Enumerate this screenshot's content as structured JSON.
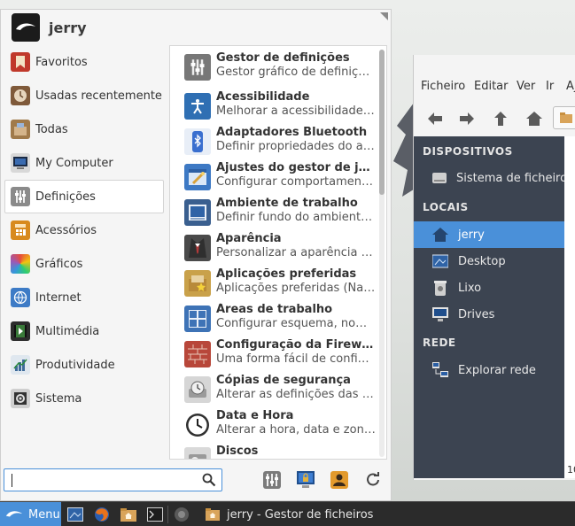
{
  "file_manager": {
    "menu": [
      "Ficheiro",
      "Editar",
      "Ver",
      "Ir",
      "Aj"
    ],
    "sections": {
      "devices": "DISPOSITIVOS",
      "places": "LOCAIS",
      "network": "REDE"
    },
    "devices": [
      {
        "label": "Sistema de ficheiros",
        "icon": "drive-icon"
      }
    ],
    "places": [
      {
        "label": "jerry",
        "icon": "home-folder-icon",
        "selected": true
      },
      {
        "label": "Desktop",
        "icon": "desktop-icon"
      },
      {
        "label": "Lixo",
        "icon": "trash-icon"
      },
      {
        "label": "Drives",
        "icon": "monitor-icon"
      }
    ],
    "network": [
      {
        "label": "Explorar rede",
        "icon": "network-icon"
      }
    ],
    "status_fragment": "10"
  },
  "menu": {
    "username": "jerry",
    "categories": [
      {
        "label": "Favoritos",
        "icon": "bookmark-icon",
        "color": "#c0392b"
      },
      {
        "label": "Usadas recentemente",
        "icon": "clock-icon",
        "color": "#7f5a3a"
      },
      {
        "label": "Todas",
        "icon": "apps-box-icon",
        "color": "#a07a4a"
      },
      {
        "label": "My Computer",
        "icon": "computer-icon",
        "color": "#2d3e55"
      },
      {
        "label": "Definições",
        "icon": "settings-sliders-icon",
        "color": "#7a7a7a",
        "selected": true
      },
      {
        "label": "Acessórios",
        "icon": "calculator-icon",
        "color": "#d88a1e"
      },
      {
        "label": "Gráficos",
        "icon": "palette-icon",
        "color": "#e34a8a"
      },
      {
        "label": "Internet",
        "icon": "globe-icon",
        "color": "#3d7bc6"
      },
      {
        "label": "Multimédia",
        "icon": "media-icon",
        "color": "#2c2c2c"
      },
      {
        "label": "Produtividade",
        "icon": "chart-icon",
        "color": "#3e6b9a"
      },
      {
        "label": "Sistema",
        "icon": "system-gear-icon",
        "color": "#555555"
      }
    ],
    "apps": [
      {
        "name": "Gestor de definições",
        "desc": "Gestor gráfico de definições do Xfce",
        "icon": "settings-sliders-icon",
        "color": "#777777"
      },
      {
        "name": "Acessibilidade",
        "desc": "Melhorar a acessibilidade do teclado e rato",
        "icon": "accessibility-icon",
        "color": "#2f6fb3"
      },
      {
        "name": "Adaptadores Bluetooth",
        "desc": "Definir propriedades do adaptador Bluetooth",
        "icon": "bluetooth-icon",
        "color": "#3a6fcf"
      },
      {
        "name": "Ajustes do gestor de janelas",
        "desc": "Configurar comportamento das janelas",
        "icon": "window-tweaks-icon",
        "color": "#3d79c4"
      },
      {
        "name": "Ambiente de trabalho",
        "desc": "Definir fundo do ambiente de trabalho",
        "icon": "desktop-settings-icon",
        "color": "#3a5f8f"
      },
      {
        "name": "Aparência",
        "desc": "Personalizar a aparência do ambiente",
        "icon": "appearance-icon",
        "color": "#4a4a4a"
      },
      {
        "name": "Aplicações preferidas",
        "desc": "Aplicações preferidas (Navegador, Cliente de email)",
        "icon": "preferred-apps-icon",
        "color": "#c9a14a"
      },
      {
        "name": "Áreas de trabalho",
        "desc": "Configurar esquema, nomes e margens",
        "icon": "workspaces-icon",
        "color": "#3e73b6"
      },
      {
        "name": "Configuração da Firewall",
        "desc": "Uma forma fácil de configurar a firewall",
        "icon": "firewall-icon",
        "color": "#b8473a"
      },
      {
        "name": "Cópias de segurança",
        "desc": "Alterar as definições das cópias de segurança",
        "icon": "backup-icon",
        "color": "#8a8a8a"
      },
      {
        "name": "Data e Hora",
        "desc": "Alterar a hora, data e zona horária",
        "icon": "clock-icon",
        "color": "#333333"
      },
      {
        "name": "Discos",
        "desc": "",
        "icon": "disks-icon",
        "color": "#9a9a9a"
      }
    ],
    "search": {
      "value": "",
      "placeholder": ""
    }
  },
  "panel": {
    "menu_label": "Menu",
    "task_title": "jerry - Gestor de ficheiros"
  }
}
